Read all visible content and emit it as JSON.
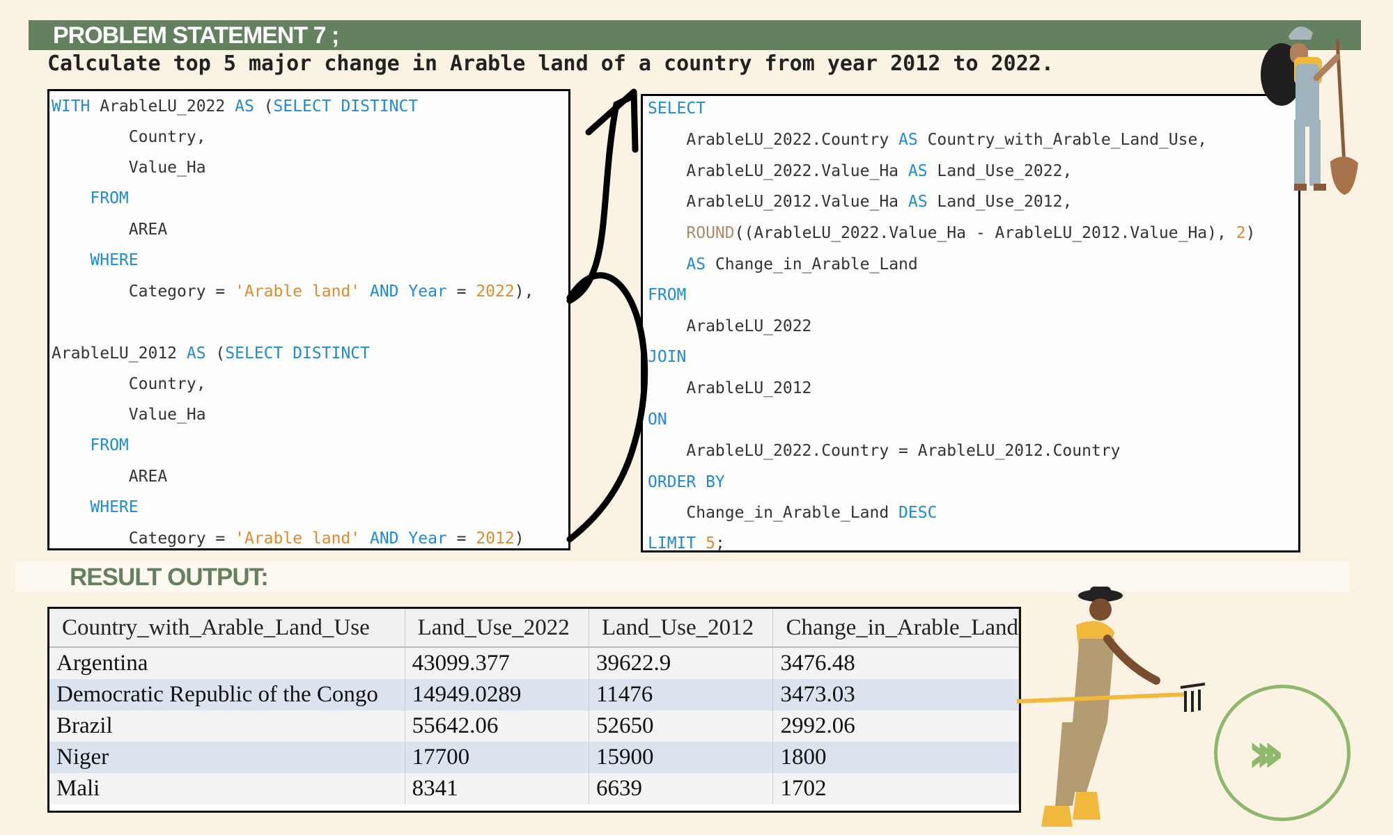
{
  "header": {
    "title": "PROBLEM STATEMENT 7 ;",
    "subtitle": "Calculate top 5 major change in Arable land of a country from year 2012 to 2022."
  },
  "query_left": {
    "lines": [
      "WITH ArableLU_2022 AS (SELECT DISTINCT",
      "        Country,",
      "        Value_Ha",
      "    FROM",
      "        AREA",
      "    WHERE",
      "        Category = 'Arable land' AND Year = 2022),",
      "ArableLU_2012 AS (SELECT DISTINCT",
      "        Country,",
      "        Value_Ha",
      "    FROM",
      "        AREA",
      "    WHERE",
      "        Category = 'Arable land' AND Year = 2012)"
    ]
  },
  "query_right": {
    "lines": [
      "SELECT",
      "    ArableLU_2022.Country AS Country_with_Arable_Land_Use,",
      "    ArableLU_2022.Value_Ha AS Land_Use_2022,",
      "    ArableLU_2012.Value_Ha AS Land_Use_2012,",
      "    ROUND((ArableLU_2022.Value_Ha - ArableLU_2012.Value_Ha), 2)",
      "    AS Change_in_Arable_Land",
      "FROM",
      "    ArableLU_2022",
      "JOIN",
      "    ArableLU_2012",
      "ON",
      "    ArableLU_2022.Country = ArableLU_2012.Country",
      "ORDER BY",
      "    Change_in_Arable_Land DESC",
      "LIMIT 5;"
    ]
  },
  "result": {
    "title": "RESULT OUTPUT:",
    "columns": [
      "Country_with_Arable_Land_Use",
      "Land_Use_2022",
      "Land_Use_2012",
      "Change_in_Arable_Land"
    ],
    "rows": [
      [
        "Argentina",
        "43099.377",
        "39622.9",
        "3476.48"
      ],
      [
        "Democratic Republic of the Congo",
        "14949.0289",
        "11476",
        "3473.03"
      ],
      [
        "Brazil",
        "55642.06",
        "52650",
        "2992.06"
      ],
      [
        "Niger",
        "17700",
        "15900",
        "1800"
      ],
      [
        "Mali",
        "8341",
        "6639",
        "1702"
      ]
    ]
  },
  "next_icon": "chevrons-right-icon",
  "colors": {
    "accent": "#63805f",
    "background": "#faf2e3",
    "keyword": "#1f8ad6",
    "string": "#e08a2e",
    "next": "#8fb86b"
  }
}
